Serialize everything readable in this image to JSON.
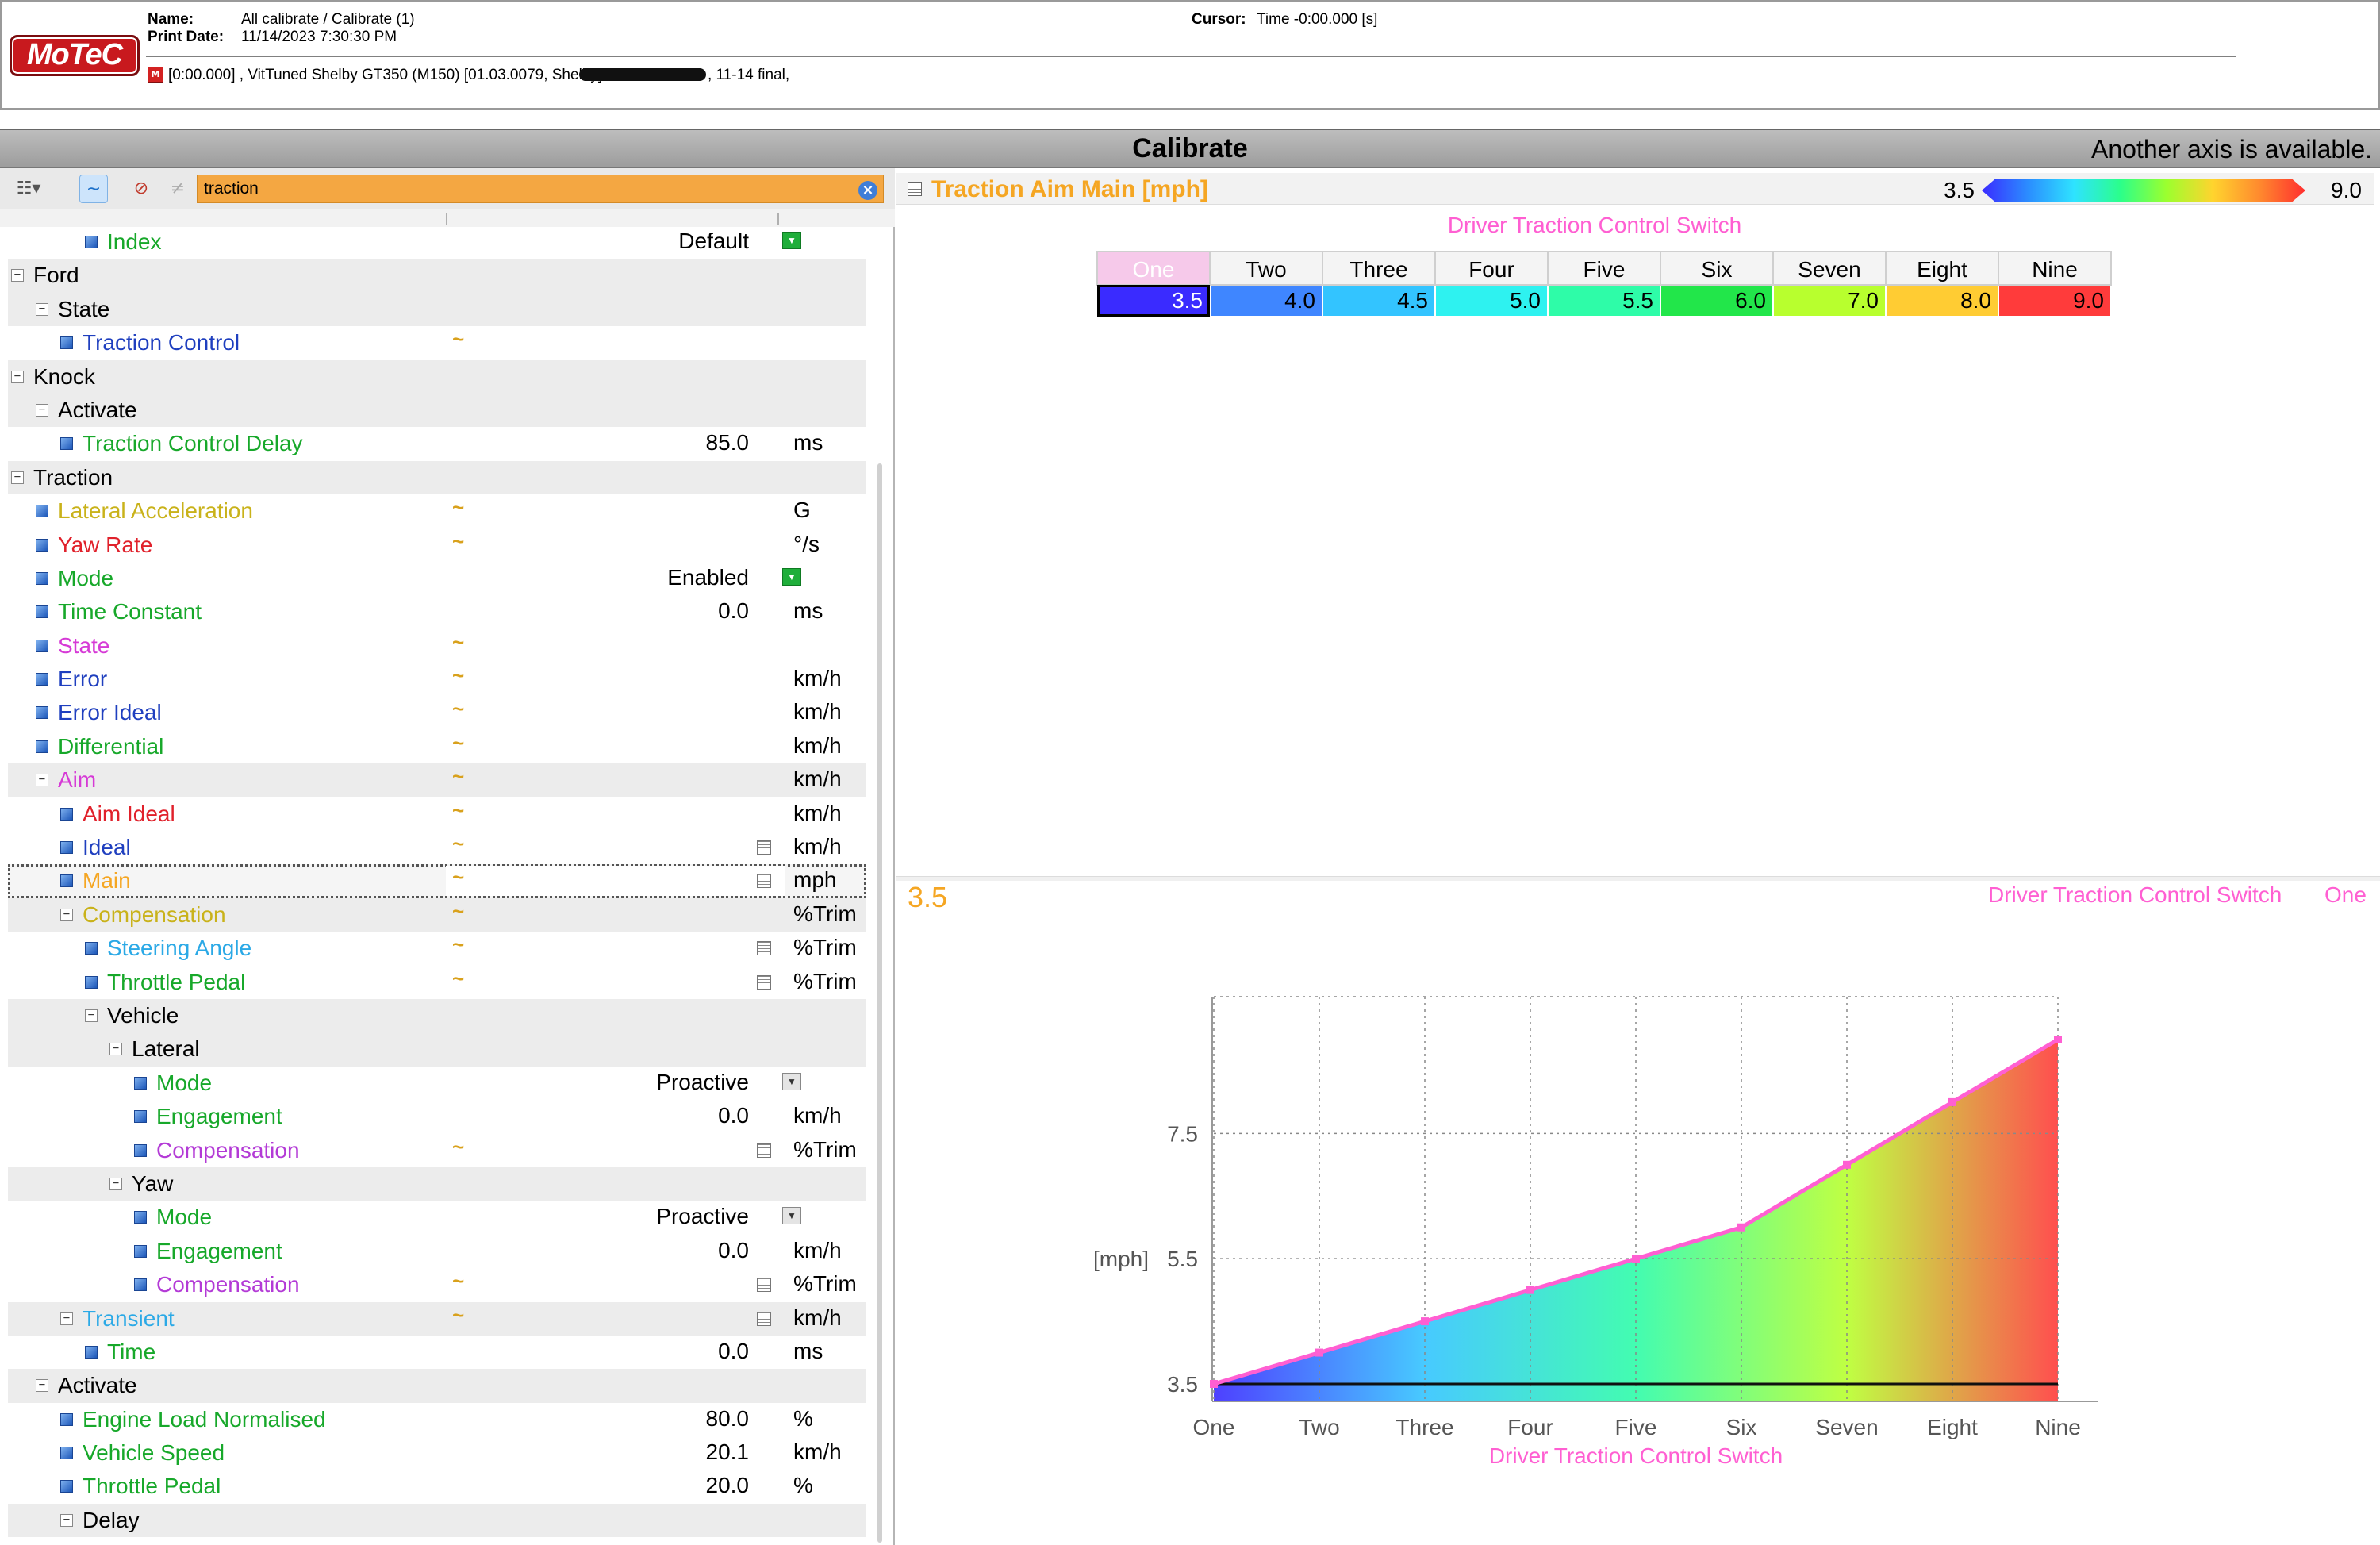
{
  "header": {
    "logo_text": "MoTeC",
    "name_label": "Name:",
    "name_value": "All calibrate / Calibrate (1)",
    "print_date_label": "Print Date:",
    "print_date_value": "11/14/2023 7:30:30 PM",
    "cursor_label": "Cursor:",
    "cursor_value": "Time  -0:00.000 [s]",
    "log_line_a": "[0:00.000] , VitTuned Shelby GT350 (M150) [01.03.0079, Shelby]",
    "log_line_b": ", 11-14 final,"
  },
  "titlebar": {
    "title": "Calibrate",
    "axis_note": "Another axis is available."
  },
  "toolbar": {
    "search_value": "traction",
    "wave_glyph": "~",
    "clear_glyph": "×"
  },
  "tree": [
    {
      "label": "Index",
      "indent": 3,
      "type": "leaf",
      "color": "#17a82a",
      "value": "Default",
      "dropdown": "green",
      "alt": false
    },
    {
      "label": "Ford",
      "indent": 0,
      "type": "group",
      "color": "#000000",
      "alt": true
    },
    {
      "label": "State",
      "indent": 1,
      "type": "group",
      "color": "#000000",
      "alt": true
    },
    {
      "label": "Traction Control",
      "indent": 2,
      "type": "leaf",
      "color": "#1f3fbf",
      "wave": true,
      "alt": false
    },
    {
      "label": "Knock",
      "indent": 0,
      "type": "group",
      "color": "#000000",
      "alt": true
    },
    {
      "label": "Activate",
      "indent": 1,
      "type": "group",
      "color": "#000000",
      "alt": true
    },
    {
      "label": "Traction Control Delay",
      "indent": 2,
      "type": "leaf",
      "color": "#17a82a",
      "value": "85.0",
      "unit": "ms",
      "alt": false
    },
    {
      "label": "Traction",
      "indent": 0,
      "type": "group",
      "color": "#000000",
      "alt": true
    },
    {
      "label": "Lateral Acceleration",
      "indent": 1,
      "type": "leaf",
      "color": "#c9b21a",
      "wave": true,
      "unit": "G",
      "alt": false
    },
    {
      "label": "Yaw Rate",
      "indent": 1,
      "type": "leaf",
      "color": "#e0212b",
      "wave": true,
      "unit": "°/s",
      "alt": false
    },
    {
      "label": "Mode",
      "indent": 1,
      "type": "leaf",
      "color": "#17a82a",
      "value": "Enabled",
      "dropdown": "green",
      "alt": false
    },
    {
      "label": "Time Constant",
      "indent": 1,
      "type": "leaf",
      "color": "#17a82a",
      "value": "0.0",
      "unit": "ms",
      "alt": false
    },
    {
      "label": "State",
      "indent": 1,
      "type": "leaf",
      "color": "#d63ad6",
      "wave": true,
      "alt": false
    },
    {
      "label": "Error",
      "indent": 1,
      "type": "leaf",
      "color": "#1f3fbf",
      "wave": true,
      "unit": "km/h",
      "alt": false
    },
    {
      "label": "Error Ideal",
      "indent": 1,
      "type": "leaf",
      "color": "#1f3fbf",
      "wave": true,
      "unit": "km/h",
      "alt": false
    },
    {
      "label": "Differential",
      "indent": 1,
      "type": "leaf",
      "color": "#17a82a",
      "wave": true,
      "unit": "km/h",
      "alt": false
    },
    {
      "label": "Aim",
      "indent": 1,
      "type": "group",
      "color": "#d63ad6",
      "wave": true,
      "unit": "km/h",
      "alt": true
    },
    {
      "label": "Aim Ideal",
      "indent": 2,
      "type": "leaf",
      "color": "#e0212b",
      "wave": true,
      "unit": "km/h",
      "alt": false
    },
    {
      "label": "Ideal",
      "indent": 2,
      "type": "leaf",
      "color": "#1f3fbf",
      "wave": true,
      "grid": true,
      "unit": "km/h",
      "alt": false
    },
    {
      "label": "Main",
      "indent": 2,
      "type": "leaf",
      "color": "#f5a623",
      "wave": true,
      "grid": true,
      "unit": "mph",
      "alt": false,
      "selected": true
    },
    {
      "label": "Compensation",
      "indent": 2,
      "type": "group",
      "color": "#c9b21a",
      "wave": true,
      "unit": "%Trim",
      "alt": true
    },
    {
      "label": "Steering Angle",
      "indent": 3,
      "type": "leaf",
      "color": "#2ba9e6",
      "wave": true,
      "grid": true,
      "unit": "%Trim",
      "alt": false
    },
    {
      "label": "Throttle Pedal",
      "indent": 3,
      "type": "leaf",
      "color": "#17a82a",
      "wave": true,
      "grid": true,
      "unit": "%Trim",
      "alt": false
    },
    {
      "label": "Vehicle",
      "indent": 3,
      "type": "group",
      "color": "#000000",
      "alt": true
    },
    {
      "label": "Lateral",
      "indent": 4,
      "type": "group",
      "color": "#000000",
      "alt": true
    },
    {
      "label": "Mode",
      "indent": 5,
      "type": "leaf",
      "color": "#17a82a",
      "value": "Proactive",
      "dropdown": "grey",
      "alt": false
    },
    {
      "label": "Engagement",
      "indent": 5,
      "type": "leaf",
      "color": "#17a82a",
      "value": "0.0",
      "unit": "km/h",
      "alt": false
    },
    {
      "label": "Compensation",
      "indent": 5,
      "type": "leaf",
      "color": "#b33ad6",
      "wave": true,
      "grid": true,
      "unit": "%Trim",
      "alt": false
    },
    {
      "label": "Yaw",
      "indent": 4,
      "type": "group",
      "color": "#000000",
      "alt": true
    },
    {
      "label": "Mode",
      "indent": 5,
      "type": "leaf",
      "color": "#17a82a",
      "value": "Proactive",
      "dropdown": "grey",
      "alt": false
    },
    {
      "label": "Engagement",
      "indent": 5,
      "type": "leaf",
      "color": "#17a82a",
      "value": "0.0",
      "unit": "km/h",
      "alt": false
    },
    {
      "label": "Compensation",
      "indent": 5,
      "type": "leaf",
      "color": "#b33ad6",
      "wave": true,
      "grid": true,
      "unit": "%Trim",
      "alt": false
    },
    {
      "label": "Transient",
      "indent": 2,
      "type": "group",
      "color": "#2ba9e6",
      "wave": true,
      "grid": true,
      "unit": "km/h",
      "alt": true
    },
    {
      "label": "Time",
      "indent": 3,
      "type": "leaf",
      "color": "#17a82a",
      "value": "0.0",
      "unit": "ms",
      "alt": false
    },
    {
      "label": "Activate",
      "indent": 1,
      "type": "group",
      "color": "#000000",
      "alt": true
    },
    {
      "label": "Engine Load Normalised",
      "indent": 2,
      "type": "leaf",
      "color": "#17a82a",
      "value": "80.0",
      "unit": "%",
      "alt": false
    },
    {
      "label": "Vehicle Speed",
      "indent": 2,
      "type": "leaf",
      "color": "#17a82a",
      "value": "20.1",
      "unit": "km/h",
      "alt": false
    },
    {
      "label": "Throttle Pedal",
      "indent": 2,
      "type": "leaf",
      "color": "#17a82a",
      "value": "20.0",
      "unit": "%",
      "alt": false
    },
    {
      "label": "Delay",
      "indent": 2,
      "type": "group",
      "color": "#000000",
      "alt": true
    }
  ],
  "map": {
    "title": "Traction Aim Main [mph]",
    "scale_min": "3.5",
    "scale_max": "9.0",
    "axis_name": "Driver Traction Control Switch",
    "columns": [
      "One",
      "Two",
      "Three",
      "Four",
      "Five",
      "Six",
      "Seven",
      "Eight",
      "Nine"
    ],
    "values": [
      "3.5",
      "4.0",
      "4.5",
      "5.0",
      "5.5",
      "6.0",
      "7.0",
      "8.0",
      "9.0"
    ],
    "cell_colors": [
      "#3a2bff",
      "#3f86ff",
      "#33c4ff",
      "#2ef2f0",
      "#2efca8",
      "#22e64a",
      "#b8ff2e",
      "#ffcc33",
      "#ff3b3b"
    ],
    "selected_index": 0
  },
  "graph_header": {
    "current_value": "3.5",
    "axis_name": "Driver Traction Control Switch",
    "current_site": "One"
  },
  "chart_data": {
    "type": "area",
    "title": "",
    "categories": [
      "One",
      "Two",
      "Three",
      "Four",
      "Five",
      "Six",
      "Seven",
      "Eight",
      "Nine"
    ],
    "series": [
      {
        "name": "",
        "values": [
          3.5,
          4.0,
          4.5,
          5.0,
          5.5,
          6.0,
          7.0,
          8.0,
          9.0
        ]
      }
    ],
    "xlabel": "Driver Traction Control Switch",
    "ylabel": "[mph]",
    "yticks": [
      "3.5",
      "5.5",
      "7.5"
    ],
    "ylim": [
      3.5,
      9.0
    ],
    "grid": true,
    "line_color": "#ff5fd2",
    "fill_colors": [
      "#3a2bff",
      "#33c4ff",
      "#2efca8",
      "#b8ff2e",
      "#ff3b3b"
    ]
  }
}
